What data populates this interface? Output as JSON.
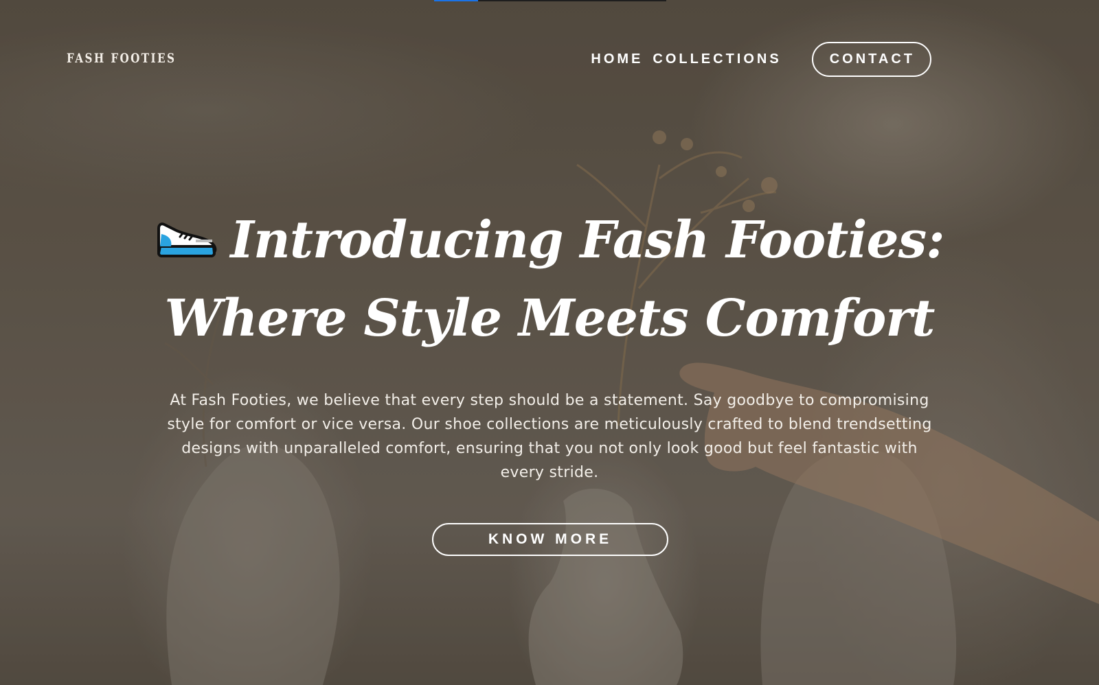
{
  "progress": {
    "value_fraction": 0.19,
    "color": "#1a73e8"
  },
  "header": {
    "logo_text": "FASH FOOTIES",
    "nav": {
      "home_label": "HOME",
      "collections_label": "COLLECTIONS",
      "contact_label": "CONTACT"
    }
  },
  "hero": {
    "icon": "sneaker-icon",
    "title_line_1": "Introducing Fash Footies:",
    "title_line_2": "Where Style Meets Comfort",
    "description": "At Fash Footies, we believe that every step should be a statement. Say goodbye to compromising style for comfort or vice versa. Our shoe collections are meticulously crafted to blend trendsetting designs with unparalleled comfort, ensuring that you not only look good but feel fantastic with every stride.",
    "cta_label": "KNOW MORE"
  },
  "colors": {
    "text": "#ffffff",
    "background": "#5f574c"
  }
}
